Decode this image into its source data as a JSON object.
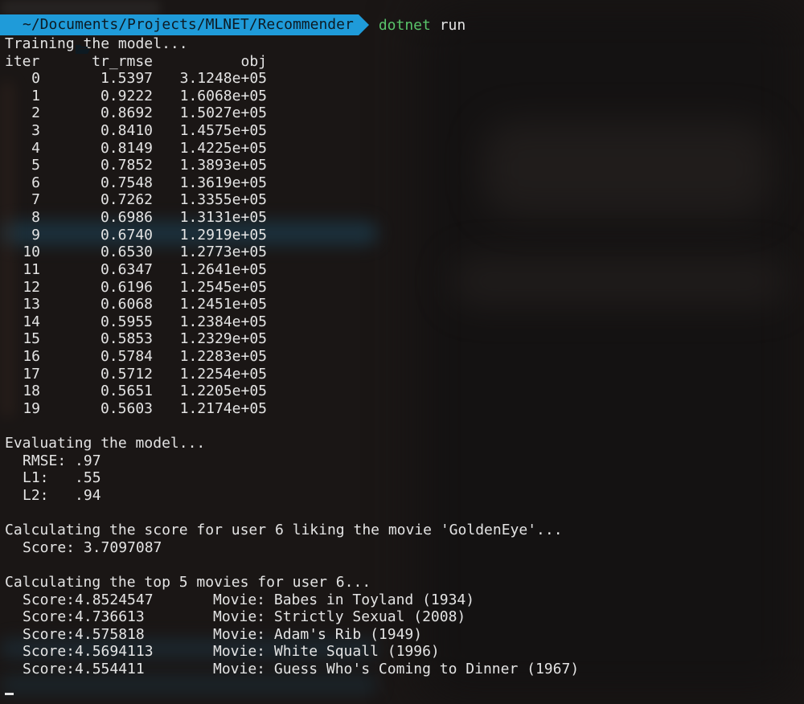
{
  "prompt": {
    "path": "~/Documents/Projects/MLNET/Recommender",
    "command": "dotnet",
    "args": "run",
    "path_bg": "#1f9bd9",
    "command_color": "#59c46a"
  },
  "training": {
    "heading": "Training the model...",
    "columns": [
      "iter",
      "tr_rmse",
      "obj"
    ],
    "rows": [
      [
        "0",
        "1.5397",
        "3.1248e+05"
      ],
      [
        "1",
        "0.9222",
        "1.6068e+05"
      ],
      [
        "2",
        "0.8692",
        "1.5027e+05"
      ],
      [
        "3",
        "0.8410",
        "1.4575e+05"
      ],
      [
        "4",
        "0.8149",
        "1.4225e+05"
      ],
      [
        "5",
        "0.7852",
        "1.3893e+05"
      ],
      [
        "6",
        "0.7548",
        "1.3619e+05"
      ],
      [
        "7",
        "0.7262",
        "1.3355e+05"
      ],
      [
        "8",
        "0.6986",
        "1.3131e+05"
      ],
      [
        "9",
        "0.6740",
        "1.2919e+05"
      ],
      [
        "10",
        "0.6530",
        "1.2773e+05"
      ],
      [
        "11",
        "0.6347",
        "1.2641e+05"
      ],
      [
        "12",
        "0.6196",
        "1.2545e+05"
      ],
      [
        "13",
        "0.6068",
        "1.2451e+05"
      ],
      [
        "14",
        "0.5955",
        "1.2384e+05"
      ],
      [
        "15",
        "0.5853",
        "1.2329e+05"
      ],
      [
        "16",
        "0.5784",
        "1.2283e+05"
      ],
      [
        "17",
        "0.5712",
        "1.2254e+05"
      ],
      [
        "18",
        "0.5651",
        "1.2205e+05"
      ],
      [
        "19",
        "0.5603",
        "1.2174e+05"
      ]
    ]
  },
  "evaluation": {
    "heading": "Evaluating the model...",
    "metrics": [
      "RMSE: .97",
      "L1:   .55",
      "L2:   .94"
    ]
  },
  "single_score": {
    "heading": "Calculating the score for user 6 liking the movie 'GoldenEye'...",
    "result": "Score: 3.7097087"
  },
  "top_movies": {
    "heading": "Calculating the top 5 movies for user 6...",
    "items": [
      {
        "score": "Score:4.8524547",
        "movie": "Movie: Babes in Toyland (1934)"
      },
      {
        "score": "Score:4.736613",
        "movie": "Movie: Strictly Sexual (2008)"
      },
      {
        "score": "Score:4.575818",
        "movie": "Movie: Adam's Rib (1949)"
      },
      {
        "score": "Score:4.5694113",
        "movie": "Movie: White Squall (1996)"
      },
      {
        "score": "Score:4.554411",
        "movie": "Movie: Guess Who's Coming to Dinner (1967)"
      }
    ]
  },
  "icons": {
    "prompt_folder": "folder-open-icon",
    "cursor": "text-cursor"
  }
}
